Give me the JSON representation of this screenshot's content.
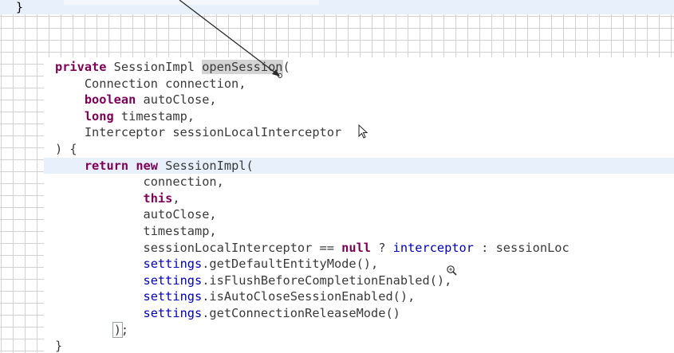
{
  "top_line": {
    "text": "}"
  },
  "code_lines": [
    [
      {
        "t": "private",
        "c": "kw"
      },
      {
        "t": " SessionImpl "
      },
      {
        "t": "openSession",
        "c": "hl-word"
      },
      {
        "t": "("
      }
    ],
    [
      {
        "t": "    Connection connection,"
      }
    ],
    [
      {
        "t": "    "
      },
      {
        "t": "boolean",
        "c": "kw"
      },
      {
        "t": " autoClose,"
      }
    ],
    [
      {
        "t": "    "
      },
      {
        "t": "long",
        "c": "kw"
      },
      {
        "t": " timestamp,"
      }
    ],
    [
      {
        "t": "    Interceptor sessionLocalInterceptor"
      }
    ],
    [
      {
        "t": ") {"
      }
    ],
    [
      {
        "t": "    "
      },
      {
        "t": "return",
        "c": "kw"
      },
      {
        "t": " "
      },
      {
        "t": "new",
        "c": "kw"
      },
      {
        "t": " SessionImpl("
      }
    ],
    [
      {
        "t": "            connection,"
      }
    ],
    [
      {
        "t": "            "
      },
      {
        "t": "this",
        "c": "kw"
      },
      {
        "t": ","
      }
    ],
    [
      {
        "t": "            autoClose,"
      }
    ],
    [
      {
        "t": "            timestamp,"
      }
    ],
    [
      {
        "t": "            sessionLocalInterceptor == "
      },
      {
        "t": "null",
        "c": "kw"
      },
      {
        "t": " ? "
      },
      {
        "t": "interceptor",
        "c": "fld"
      },
      {
        "t": " : sessionLoc"
      }
    ],
    [
      {
        "t": "            "
      },
      {
        "t": "settings",
        "c": "fld"
      },
      {
        "t": ".getDefaultEntityMode(),"
      }
    ],
    [
      {
        "t": "            "
      },
      {
        "t": "settings",
        "c": "fld"
      },
      {
        "t": ".isFlushBeforeCompletionEnabled(),"
      }
    ],
    [
      {
        "t": "            "
      },
      {
        "t": "settings",
        "c": "fld"
      },
      {
        "t": ".isAutoCloseSessionEnabled(),"
      }
    ],
    [
      {
        "t": "            "
      },
      {
        "t": "settings",
        "c": "fld"
      },
      {
        "t": ".getConnectionReleaseMode()"
      }
    ],
    [
      {
        "t": "        "
      },
      {
        "t": ")",
        "c": "box"
      },
      {
        "t": ";"
      }
    ],
    [
      {
        "t": "}"
      }
    ]
  ],
  "colors": {
    "keyword": "#7f0055",
    "field": "#0000c0",
    "text": "#3a3a3a",
    "current_line": "#e8f0fb",
    "word_highlight": "#d4d4d4",
    "grid": "#d2d2d2"
  }
}
